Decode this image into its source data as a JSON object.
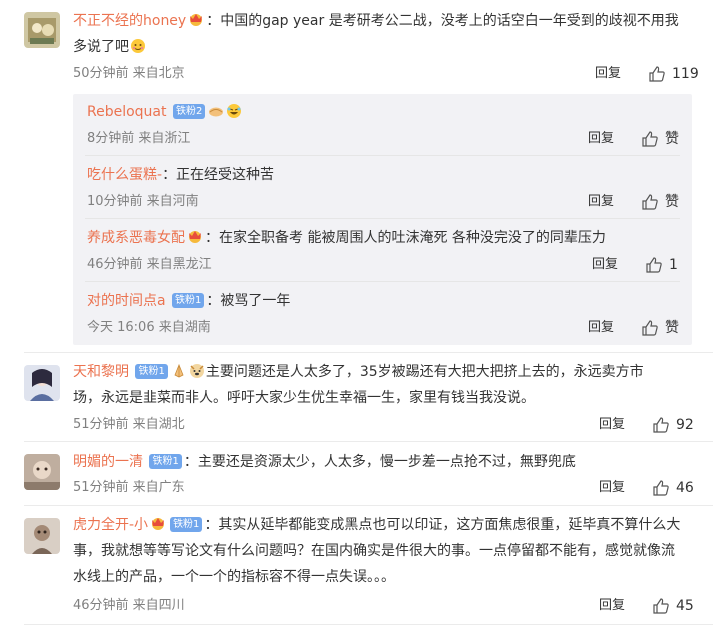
{
  "comments": [
    {
      "user": "不正不经的honey",
      "text": "：中国的gap year 是考研考公二战，没考上的话空白一年受到的歧视不用我",
      "text2": "多说了吧",
      "meta": "50分钟前 来自北京",
      "reply": "回复",
      "likes": "119"
    },
    {
      "user": "天和黎明",
      "badge": "铁粉1",
      "text": "主要问题还是人太多了，35岁被踢还有大把大把挤上去的，永远卖方市",
      "text2": "场，永远是韭菜而非人。呼吁大家少生优生幸福一生，家里有钱当我没说。",
      "meta": "51分钟前 来自湖北",
      "reply": "回复",
      "likes": "92"
    },
    {
      "user": "明媚的一清",
      "badge": "铁粉1",
      "text": "：主要还是资源太少，人太多，慢一步差一点抢不过，無野兜底",
      "meta": "51分钟前 来自广东",
      "reply": "回复",
      "likes": "46"
    },
    {
      "user": "虎力全开-小",
      "badge": "铁粉1",
      "text": "：其实从延毕都能变成黑点也可以印证，这方面焦虑很重，延毕真不算什么大",
      "text2": "事，我就想等等写论文有什么问题吗？在国内确实是件很大的事。一点停留都不能有，感觉就像流",
      "text3": "水线上的产品，一个一个的指标容不得一点失误。。。",
      "meta": "46分钟前 来自四川",
      "reply": "回复",
      "likes": "45"
    }
  ],
  "replies": [
    {
      "user": "Rebeloquat",
      "badge": "铁粉2",
      "text": "",
      "meta": "8分钟前 来自浙江",
      "reply": "回复",
      "likes": "赞"
    },
    {
      "user": "吃什么蛋糕-",
      "text": "：正在经受这种苦",
      "meta": "10分钟前 来自河南",
      "reply": "回复",
      "likes": "赞"
    },
    {
      "user": "养成系恶毒女配",
      "text": "：在家全职备考 能被周围人的吐沫淹死 各种没完没了的同辈压力",
      "meta": "46分钟前 来自黑龙江",
      "reply": "回复",
      "likes": "1"
    },
    {
      "user": "对的时间点a",
      "badge": "铁粉1",
      "text": "：被骂了一年",
      "meta": "今天 16:06 来自湖南",
      "reply": "回复",
      "likes": "赞"
    }
  ],
  "colors": {
    "username": "#eb7350",
    "badge": "#71a6ec",
    "meta": "#808080",
    "subbox": "#f2f2f5"
  }
}
